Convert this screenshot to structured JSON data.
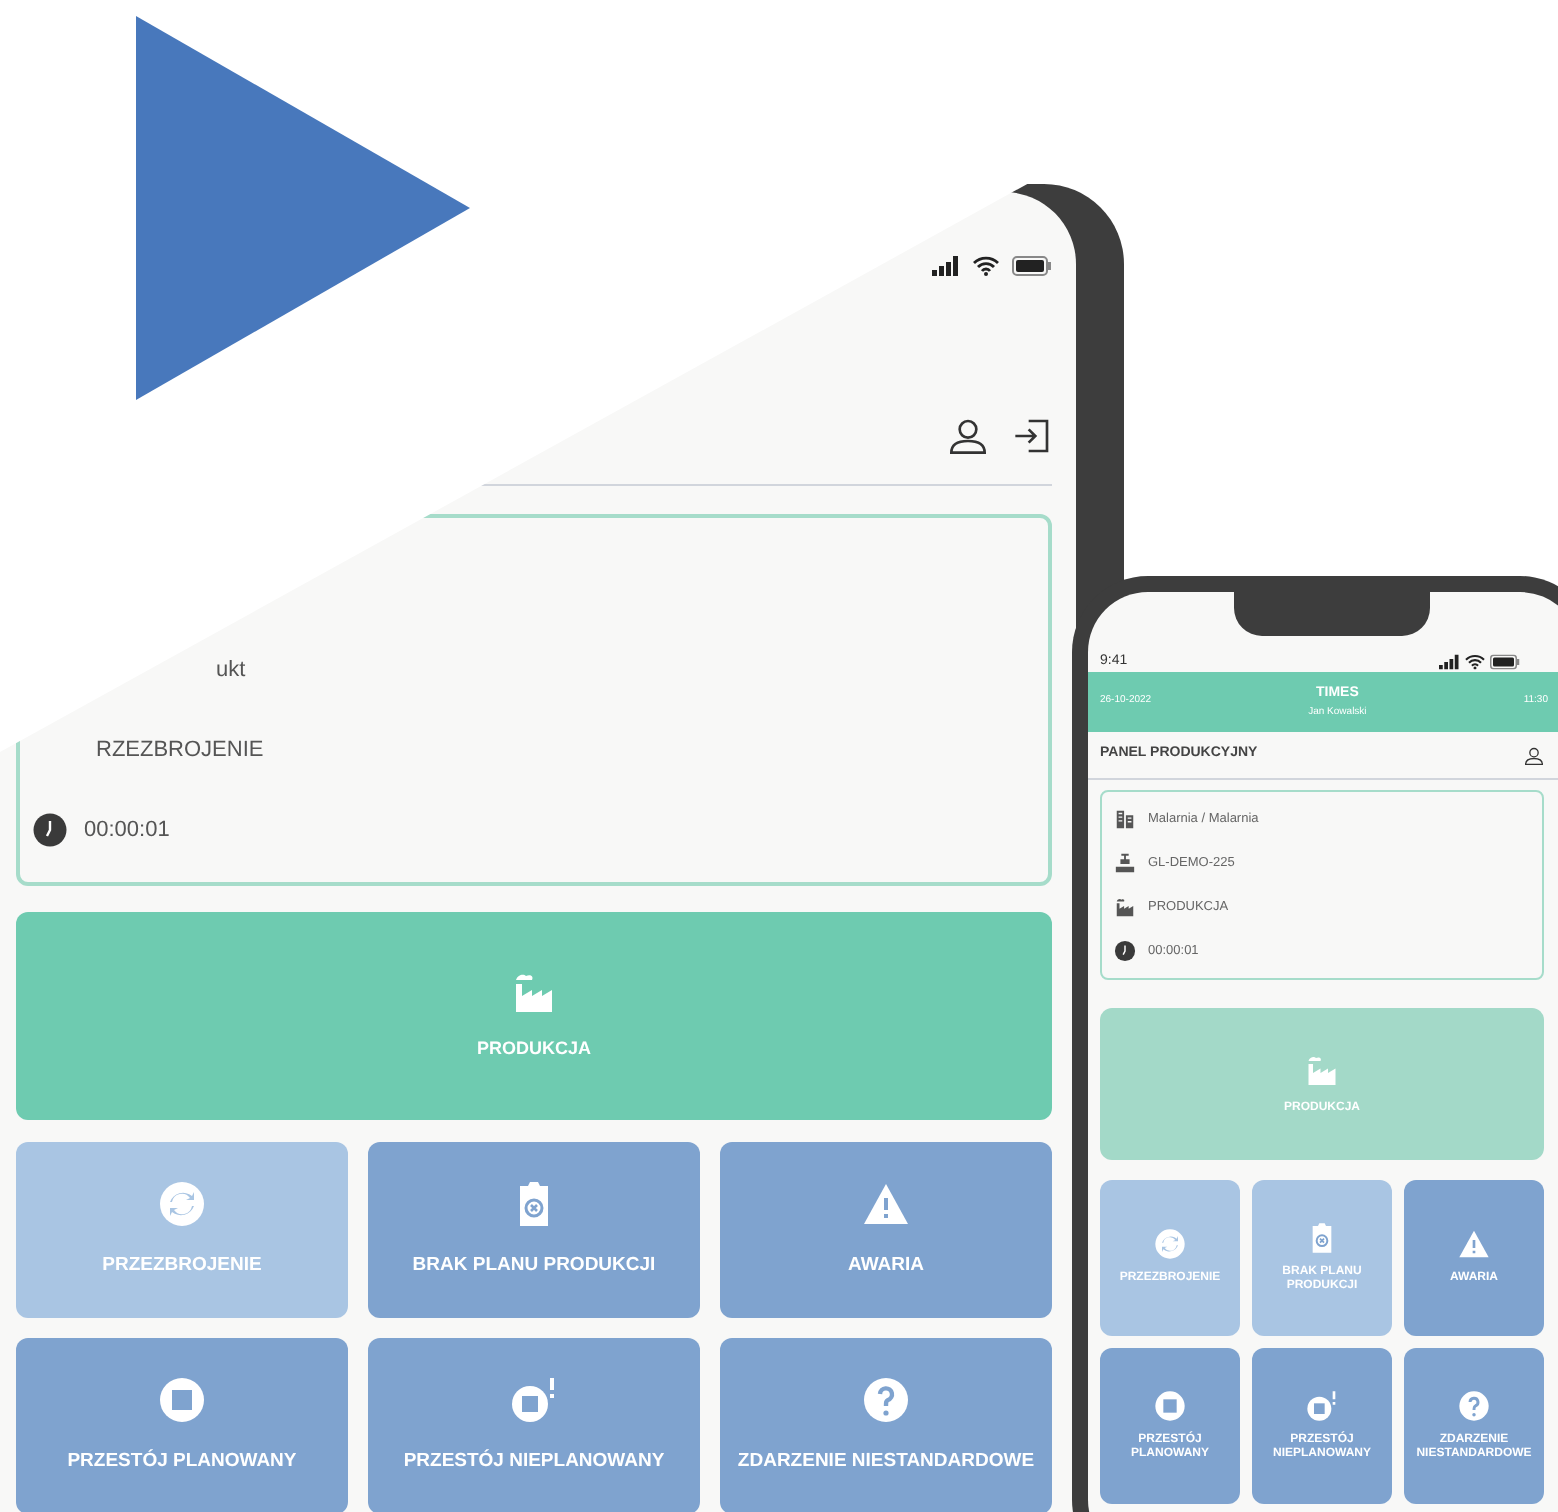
{
  "tablet": {
    "info_rows": [
      {
        "kind": "product",
        "text": "ukt"
      },
      {
        "kind": "state",
        "text": "RZEZBROJENIE"
      },
      {
        "kind": "timer",
        "text": "00:00:01"
      }
    ],
    "main_action": {
      "kind": "production",
      "label": "PRODUKCJA",
      "dimmed": false
    },
    "tiles": [
      {
        "kind": "changeover",
        "label": "PRZEZBROJENIE",
        "dimmed": true
      },
      {
        "kind": "no-plan",
        "label": "BRAK PLANU PRODUKCJI",
        "dimmed": false
      },
      {
        "kind": "failure",
        "label": "AWARIA",
        "dimmed": false
      },
      {
        "kind": "planned-stop",
        "label": "PRZESTÓJ PLANOWANY",
        "dimmed": false
      },
      {
        "kind": "unplanned-stop",
        "label": "PRZESTÓJ NIEPLANOWANY",
        "dimmed": false
      },
      {
        "kind": "unusual-event",
        "label": "ZDARZENIE NIESTANDARDOWE",
        "dimmed": false
      }
    ]
  },
  "phone": {
    "time": "9:41",
    "header": {
      "date": "26-10-2022",
      "title": "TIMES",
      "user": "Jan Kowalski",
      "clock": "11:30"
    },
    "panel_title": "PANEL PRODUKCYJNY",
    "info_rows": [
      {
        "kind": "department",
        "text": "Malarnia / Malarnia"
      },
      {
        "kind": "line",
        "text": "GL-DEMO-225"
      },
      {
        "kind": "state",
        "text": "PRODUKCJA"
      },
      {
        "kind": "timer",
        "text": "00:00:01"
      }
    ],
    "main_action": {
      "kind": "production",
      "label": "PRODUKCJA",
      "dimmed": true
    },
    "tiles": [
      {
        "kind": "changeover",
        "label": "PRZEZBROJENIE",
        "dimmed": true
      },
      {
        "kind": "no-plan",
        "label": "BRAK PLANU PRODUKCJI",
        "dimmed": true
      },
      {
        "kind": "failure",
        "label": "AWARIA",
        "dimmed": false
      },
      {
        "kind": "planned-stop",
        "label": "PRZESTÓJ PLANOWANY",
        "dimmed": false
      },
      {
        "kind": "unplanned-stop",
        "label": "PRZESTÓJ NIEPLANOWANY",
        "dimmed": false
      },
      {
        "kind": "unusual-event",
        "label": "ZDARZENIE NIESTANDARDOWE",
        "dimmed": false
      }
    ]
  }
}
